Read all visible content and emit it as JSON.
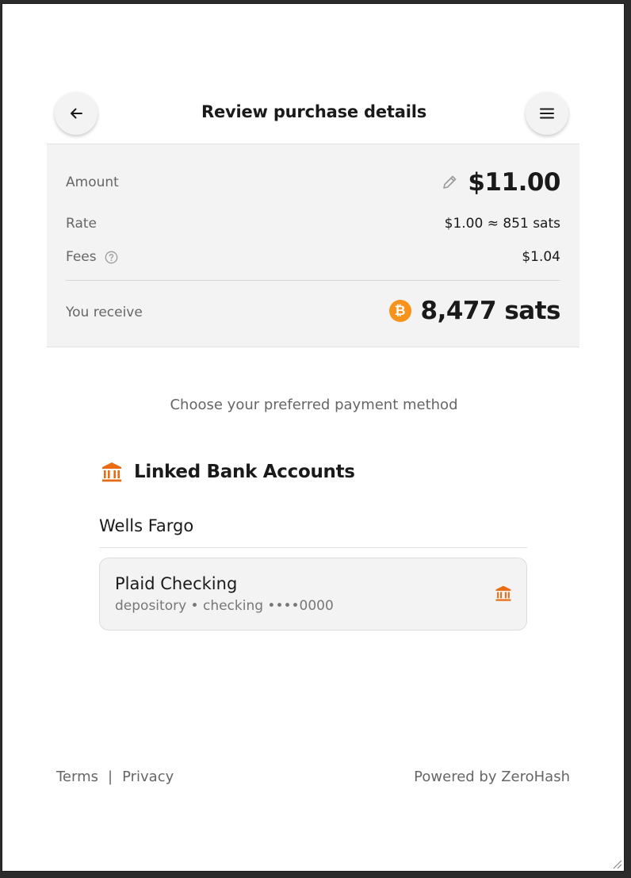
{
  "header": {
    "title": "Review purchase details",
    "back_icon": "arrow-left-icon",
    "menu_icon": "hamburger-menu-icon"
  },
  "summary": {
    "amount_label": "Amount",
    "amount_value": "$11.00",
    "rate_label": "Rate",
    "rate_value": "$1.00 ≈ 851 sats",
    "fees_label": "Fees",
    "fees_value": "$1.04",
    "receive_label": "You receive",
    "receive_value": "8,477 sats",
    "btc_symbol": "₿"
  },
  "payment": {
    "prompt": "Choose your preferred payment method",
    "section_title": "Linked Bank Accounts",
    "bank_name": "Wells Fargo",
    "accounts": [
      {
        "name": "Plaid Checking",
        "details": "depository • checking ••••0000"
      }
    ]
  },
  "footer": {
    "terms": "Terms",
    "separator": "|",
    "privacy": "Privacy",
    "powered_by": "Powered by ZeroHash"
  },
  "colors": {
    "accent": "#ea6b12",
    "bitcoin": "#f7931a",
    "panel": "#f3f3f3"
  }
}
